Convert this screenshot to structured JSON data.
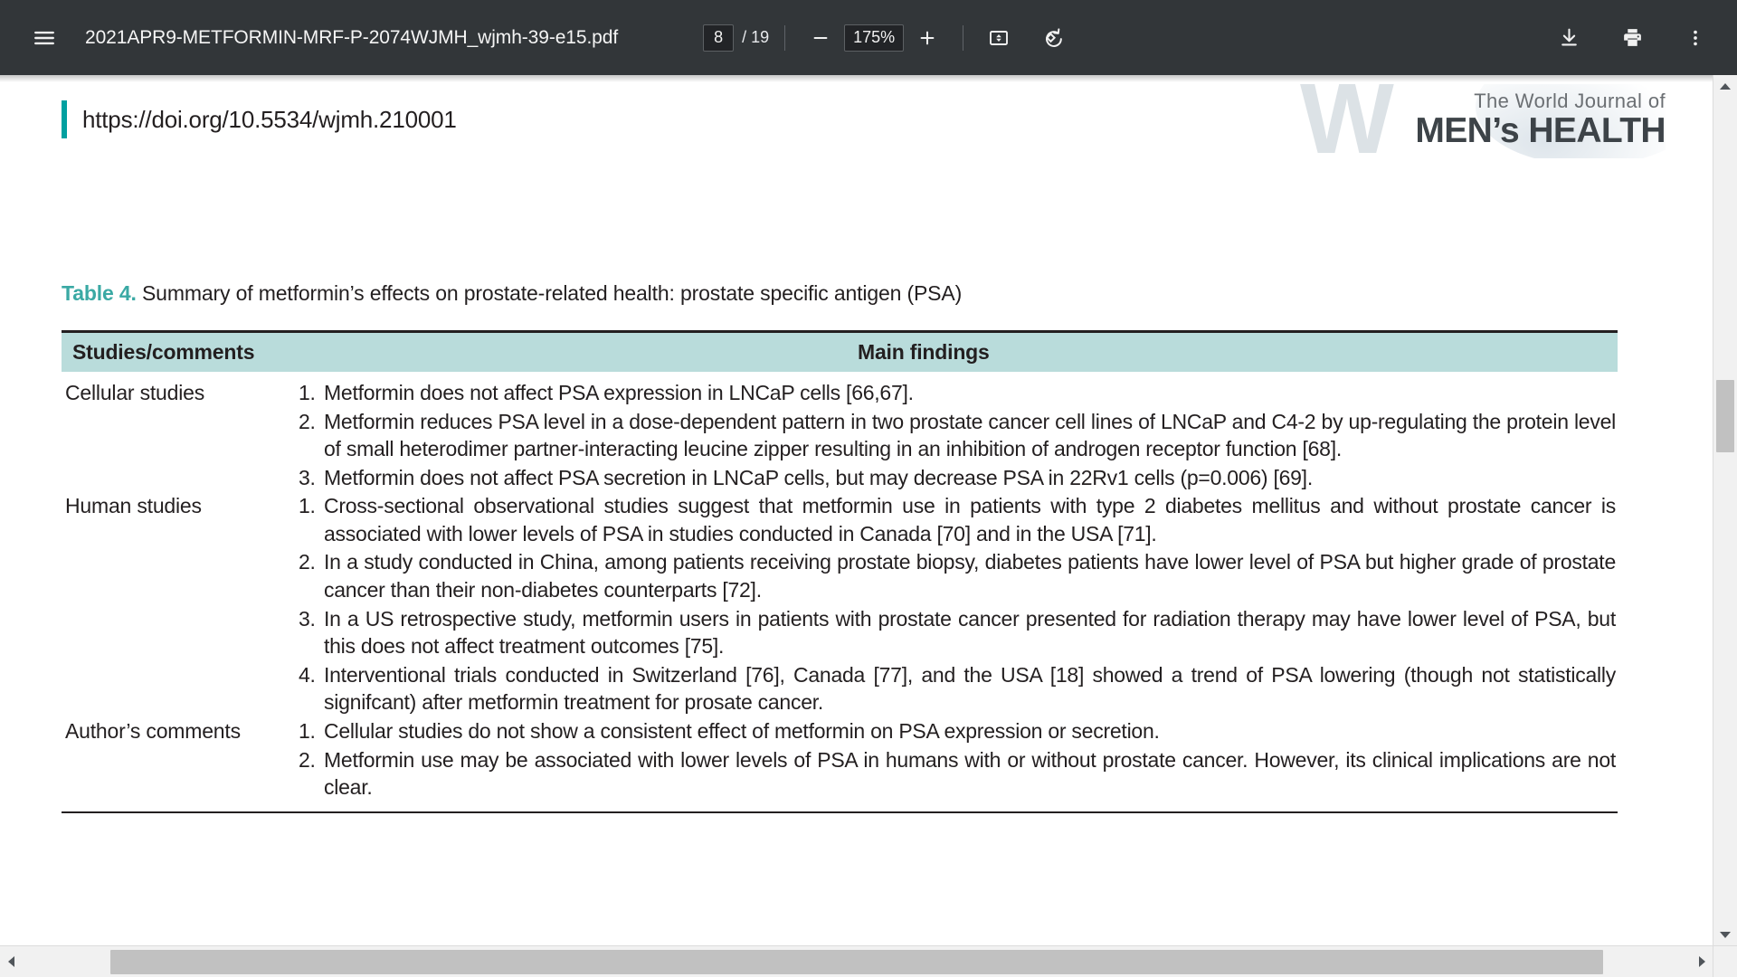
{
  "toolbar": {
    "menu_icon": "hamburger-menu-icon",
    "document_title": "2021APR9-METFORMIN-MRF-P-2074WJMH_wjmh-39-e15.pdf",
    "current_page": "8",
    "page_total": "/ 19",
    "zoom_out_icon": "minus-icon",
    "zoom_level": "175%",
    "zoom_in_icon": "plus-icon",
    "fit_page_icon": "fit-to-page-icon",
    "rotate_icon": "rotate-counterclockwise-icon",
    "download_icon": "download-icon",
    "print_icon": "print-icon",
    "more_icon": "more-options-kebab-icon"
  },
  "document": {
    "doi": "https://doi.org/10.5534/wjmh.210001",
    "logo": {
      "watermark_letter": "W",
      "line1": "The World Journal of",
      "line2": "MEN’s HEALTH"
    },
    "caption": {
      "label": "Table 4.",
      "text": " Summary of metformin’s effects on prostate-related health: prostate specific antigen (PSA)"
    },
    "table": {
      "headers": {
        "col1": "Studies/comments",
        "col2": "Main findings"
      },
      "rows": [
        {
          "label": "Cellular studies",
          "findings": [
            {
              "num": "1.",
              "text": "Metformin does not affect PSA expression in LNCaP cells [66,67]."
            },
            {
              "num": "2.",
              "text": "Metformin reduces PSA level in a dose-dependent pattern in two prostate cancer cell lines of LNCaP and C4-2 by up-regulating the protein level of small heterodimer partner-interacting leucine zipper resulting in an inhibition of androgen receptor function [68]."
            },
            {
              "num": "3.",
              "text": "Metformin does not affect PSA secretion in LNCaP cells, but may decrease PSA in 22Rv1 cells (p=0.006) [69]."
            }
          ]
        },
        {
          "label": "Human studies",
          "findings": [
            {
              "num": "1.",
              "text": "Cross-sectional observational studies suggest that metformin use in patients with type 2 diabetes mellitus and without prostate cancer is associated with lower levels of PSA in studies conducted in Canada [70] and in the USA [71]."
            },
            {
              "num": "2.",
              "text": "In a study conducted in China, among patients receiving prostate biopsy, diabetes patients have lower level of PSA but higher grade of prostate cancer than their non-diabetes counterparts [72]."
            },
            {
              "num": "3.",
              "text": "In a US retrospective study, metformin users in patients with prostate cancer presented for radiation therapy may have lower level of PSA, but this does not affect treatment outcomes [75]."
            },
            {
              "num": "4.",
              "text": "Interventional trials conducted in Switzerland [76], Canada [77], and the USA [18] showed a trend of PSA lowering (though not statistically signifcant) after metformin treatment for prosate cancer."
            }
          ]
        },
        {
          "label": "Author’s comments",
          "findings": [
            {
              "num": "1.",
              "text": "Cellular studies do not show a consistent effect of metformin on PSA expression or secretion."
            },
            {
              "num": "2.",
              "text": "Metformin use may be associated with lower levels of PSA in humans with or without prostate cancer. However, its clinical implications are not clear."
            }
          ]
        }
      ]
    }
  },
  "scrollbars": {
    "vertical_up_icon": "scroll-up-arrow-icon",
    "vertical_down_icon": "scroll-down-arrow-icon",
    "horizontal_left_icon": "scroll-left-arrow-icon",
    "horizontal_right_icon": "scroll-right-arrow-icon"
  },
  "colors": {
    "toolbar_bg": "#323639",
    "accent_teal": "#00a0a0",
    "table_header_bg": "#b9dcdb",
    "caption_label": "#3aa9a4"
  }
}
